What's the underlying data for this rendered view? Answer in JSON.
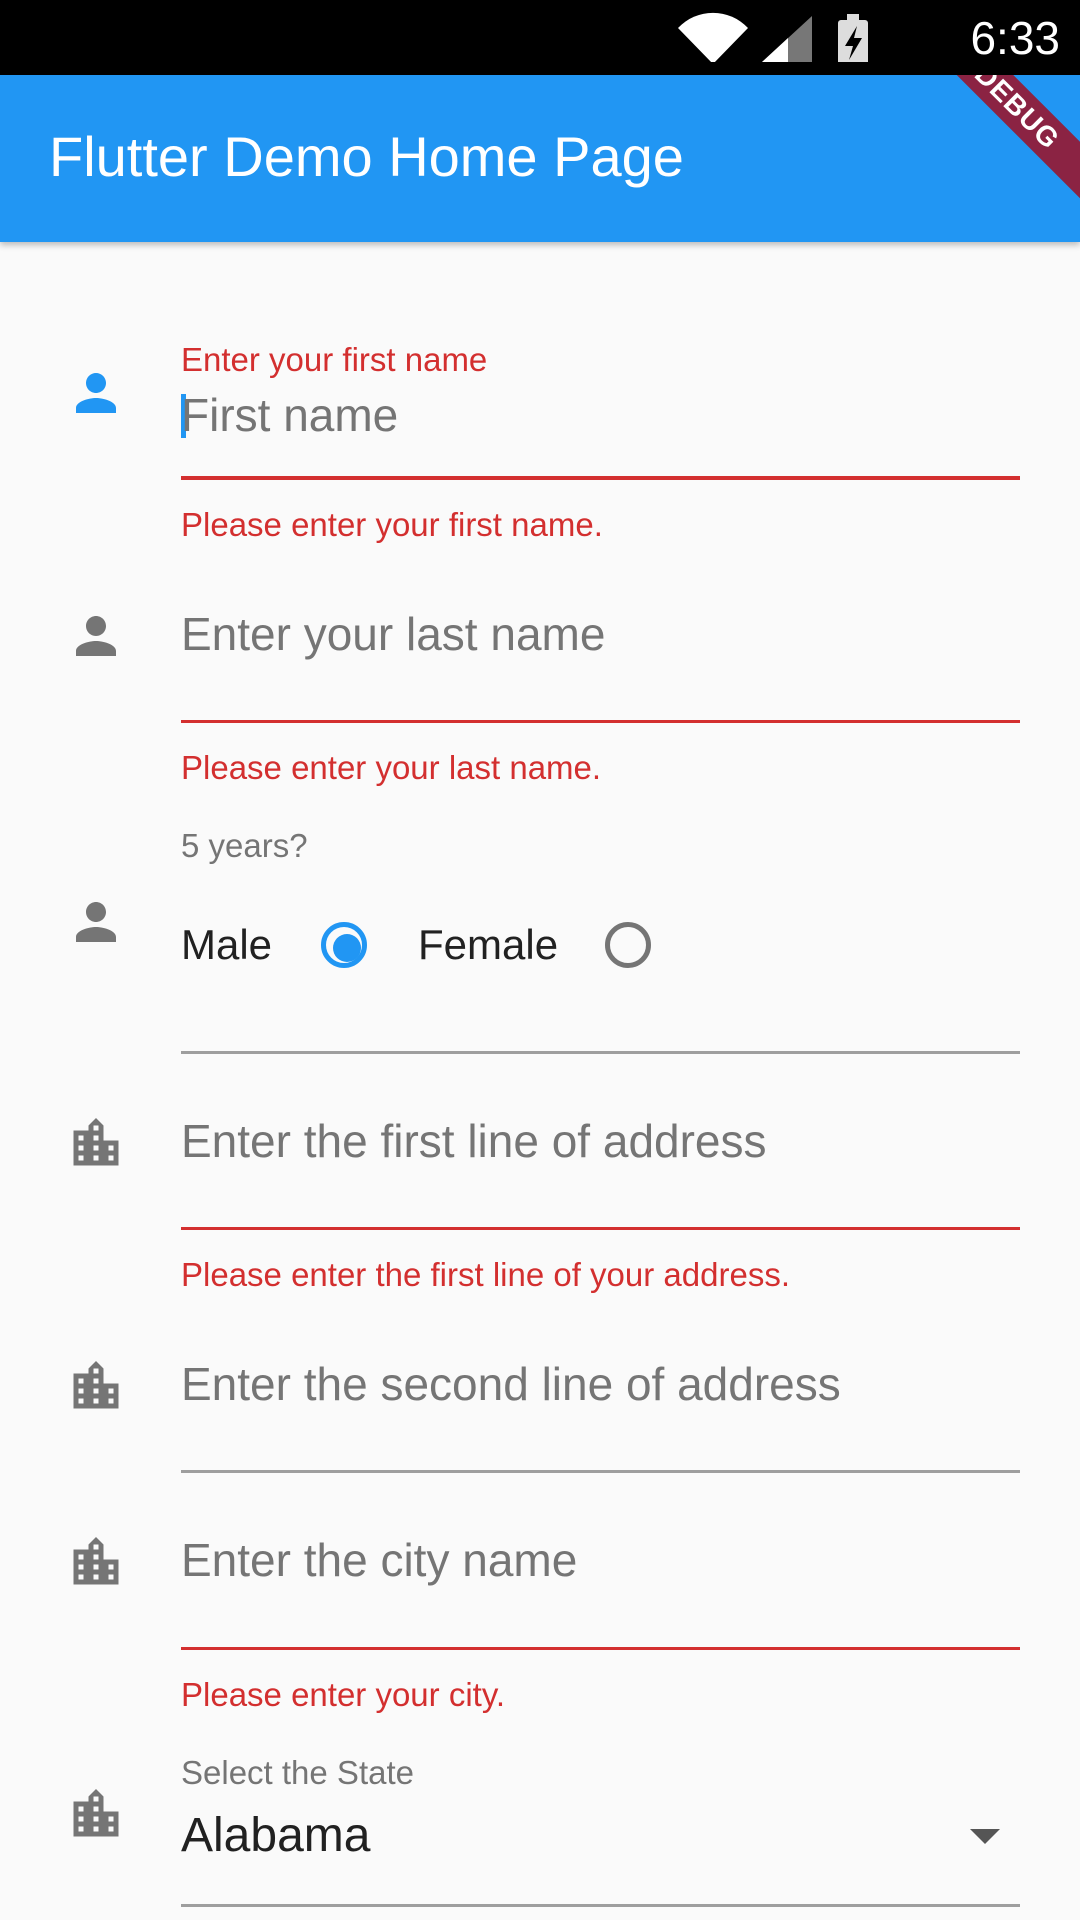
{
  "status_bar": {
    "time": "6:33"
  },
  "app_bar": {
    "title": "Flutter Demo Home Page",
    "debug_banner": "DEBUG",
    "color": "#2196f3"
  },
  "form": {
    "first_name": {
      "label": "Enter your first name",
      "hint": "First name",
      "error": "Please enter your first name."
    },
    "last_name": {
      "hint": "Enter your last name",
      "error": "Please enter your last name."
    },
    "gender": {
      "label": "5 years?",
      "options": [
        "Male",
        "Female"
      ],
      "selected": "Male"
    },
    "address_line1": {
      "hint": "Enter the first line of address",
      "error": "Please enter the first line of your address."
    },
    "address_line2": {
      "hint": "Enter the second line of address"
    },
    "city": {
      "hint": "Enter the city name",
      "error": "Please enter your city."
    },
    "state": {
      "label": "Select the State",
      "value": "Alabama"
    }
  },
  "colors": {
    "primary": "#2196f3",
    "error": "#d32f2f",
    "icon_grey": "#757575"
  },
  "icons": [
    "person-icon",
    "location-city-icon",
    "arrow-drop-down-icon",
    "wifi-icon",
    "signal-icon",
    "battery-charging-icon"
  ]
}
